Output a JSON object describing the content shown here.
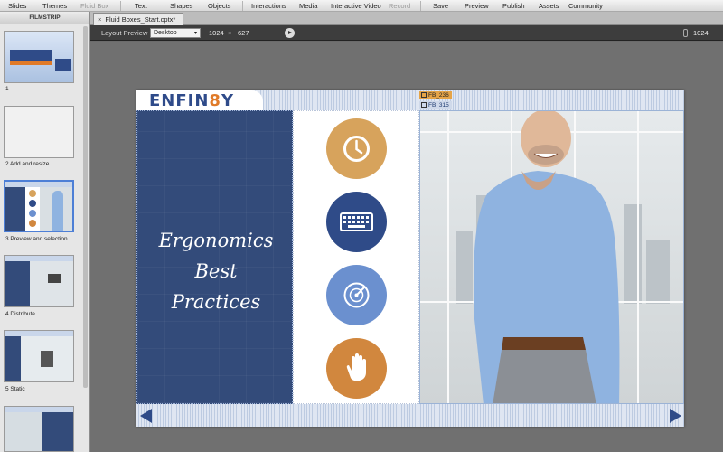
{
  "menubar": {
    "items": [
      {
        "label": "Slides",
        "disabled": false
      },
      {
        "label": "Themes",
        "disabled": false
      },
      {
        "label": "Fluid Box",
        "disabled": true
      },
      {
        "label": "Text",
        "disabled": false
      },
      {
        "label": "Shapes",
        "disabled": false
      },
      {
        "label": "Objects",
        "disabled": false
      },
      {
        "label": "Interactions",
        "disabled": false
      },
      {
        "label": "Media",
        "disabled": false
      },
      {
        "label": "Interactive Video",
        "disabled": false
      },
      {
        "label": "Record",
        "disabled": true
      },
      {
        "label": "Save",
        "disabled": false
      },
      {
        "label": "Preview",
        "disabled": false
      },
      {
        "label": "Publish",
        "disabled": false
      },
      {
        "label": "Assets",
        "disabled": false
      },
      {
        "label": "Community",
        "disabled": false
      }
    ]
  },
  "filmstrip": {
    "header": "FILMSTRIP",
    "slides": [
      {
        "label": "1"
      },
      {
        "label": "2 Add and resize"
      },
      {
        "label": "3 Preview and selection"
      },
      {
        "label": "4 Distribute"
      },
      {
        "label": "5 Static"
      }
    ],
    "selected_index": 2
  },
  "tabs": {
    "close_glyph": "×",
    "active": "Fluid Boxes_Start.cptx*"
  },
  "layout_preview": {
    "label": "Layout Preview",
    "device": "Desktop",
    "width": "1024",
    "x_glyph": "×",
    "height": "627",
    "ruler_width": "1024"
  },
  "slide": {
    "logo_prefix": "ENFIN",
    "logo_eight": "8",
    "logo_suffix": "Y",
    "fluid_box_labels": [
      "FB_236",
      "FB_315"
    ],
    "title_line1": "Ergonomics Best",
    "title_line2": "Practices",
    "icons": [
      "clock-icon",
      "keyboard-icon",
      "radar-icon",
      "hand-icon"
    ],
    "colors": {
      "navy": "#334b7a",
      "gold": "#d7a35c",
      "light_blue": "#6b90cf",
      "orange": "#d1873e"
    }
  }
}
